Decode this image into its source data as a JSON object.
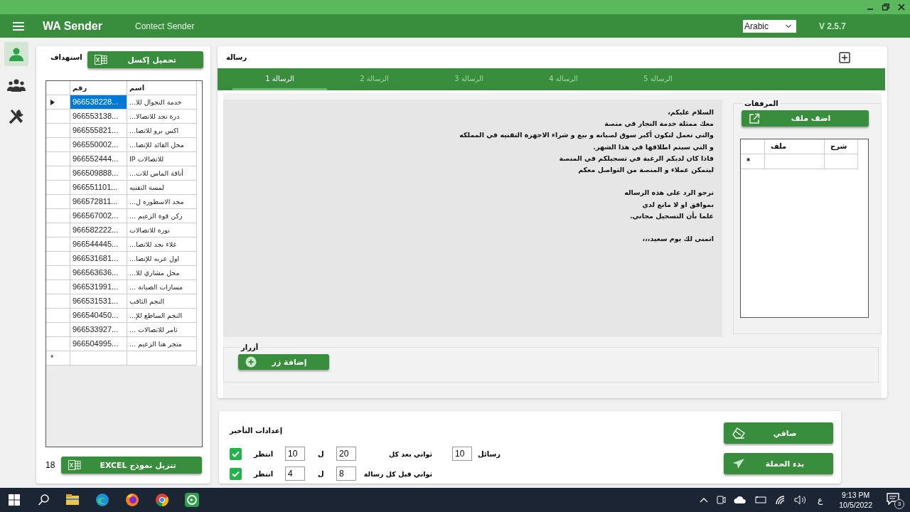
{
  "header": {
    "title": "WA Sender",
    "subtitle": "Contect Sender",
    "language": "Arabic",
    "version": "V 2.5.7"
  },
  "sidebar": {
    "items": [
      {
        "kind": "person",
        "selected": true
      },
      {
        "kind": "group",
        "selected": false
      },
      {
        "kind": "tools",
        "selected": false
      }
    ]
  },
  "targets": {
    "title": "استهداف",
    "load_button": "تحميل إكسل",
    "columns": [
      "اسم",
      "رقم"
    ],
    "rows": [
      {
        "number": "966538228...",
        "name": "خدمة التجوال للا...",
        "selected": true
      },
      {
        "number": "966553138...",
        "name": "درة نجد للاتصالا...",
        "selected": false
      },
      {
        "number": "966555821...",
        "name": "اكس برو للاتصا...",
        "selected": false
      },
      {
        "number": "966550002...",
        "name": "محل القائد للإتصا...",
        "selected": false
      },
      {
        "number": "966552444...",
        "name": "للاتصالات IP",
        "selected": false
      },
      {
        "number": "966509888...",
        "name": "أناقة الماس للات...",
        "selected": false
      },
      {
        "number": "966551101...",
        "name": "لمسة التقنيه",
        "selected": false
      },
      {
        "number": "966572811...",
        "name": "مجد الاسطوره ل...",
        "selected": false
      },
      {
        "number": "966567002...",
        "name": "ركن قوة الزعيم ...",
        "selected": false
      },
      {
        "number": "966582222...",
        "name": "نوره للاتصالات",
        "selected": false
      },
      {
        "number": "966544445...",
        "name": "غلاء نجد للاتصا...",
        "selected": false
      },
      {
        "number": "966531681...",
        "name": "اول عربه للإتصا...",
        "selected": false
      },
      {
        "number": "966563636...",
        "name": "محل مشاري للا...",
        "selected": false
      },
      {
        "number": "966531991...",
        "name": "مسارات الصيانة ...",
        "selected": false
      },
      {
        "number": "966531531...",
        "name": "النجم الثاقب",
        "selected": false
      },
      {
        "number": "966540450...",
        "name": "النجم الساطع للإ...",
        "selected": false
      },
      {
        "number": "966533927...",
        "name": "ثامر للاتصالات ...",
        "selected": false
      },
      {
        "number": "966504995...",
        "name": "متجر هنا الزعيم ...",
        "selected": false
      }
    ],
    "new_row_marker": "*",
    "count": "18",
    "template_button": "EXCEL تنزيل نموذج"
  },
  "message": {
    "title": "رسالة",
    "tabs": [
      {
        "label": "الرسالة 5",
        "selected": false
      },
      {
        "label": "الرسالة 4",
        "selected": false
      },
      {
        "label": "الرسالة 3",
        "selected": false
      },
      {
        "label": "الرسالة 2",
        "selected": false
      },
      {
        "label": "الرسالة 1",
        "selected": true
      }
    ],
    "body": "السلام عليكم،\nمعك ممثلة خدمة التجار في منصة\nوالتي تعمل لتكون أكبر سوق لصيانه و بيع و شراء الاجهزة التقنيه في المملكه\nو التي سيتم اطلاقها في هذا الشهر.\nفاذا كان لديكم الرغبة في تسجيلكم في المنصة\nليتمكن عملاء و المنصة من التواصل معكم\n\nنرجو الرد على هذه الرساله\nبموافق او لا مانع لدي\nعلما بأن التسجيل مجاني.\n\nاتمنى لك يوم سعيد،،،",
    "attachments": {
      "title": "المرفقات",
      "add_button": "اضف ملف",
      "columns": [
        "شرح",
        "ملف"
      ],
      "new_row_marker": "*"
    },
    "buttons_group": {
      "title": "أزرار",
      "add_button": "إضافة زر"
    }
  },
  "delay": {
    "title": "إعدادات التأخير",
    "rows": [
      {
        "checked": true,
        "wait_label": "انتظر",
        "min": "10",
        "to_label": "ل",
        "max": "20",
        "unit_label": "ثواني بعد كل",
        "count": "10",
        "count_label": "رسائل"
      },
      {
        "checked": true,
        "wait_label": "انتظر",
        "min": "4",
        "to_label": "ل",
        "max": "8",
        "unit_label": "ثواني قبل كل رسالة"
      }
    ],
    "clear_button": "صافي",
    "start_button": "بدء الحملة"
  },
  "taskbar": {
    "apps": [
      {
        "kind": "explorer"
      },
      {
        "kind": "edge"
      },
      {
        "kind": "firefox"
      },
      {
        "kind": "chrome"
      },
      {
        "kind": "wa"
      }
    ],
    "input_language": "ع",
    "time": "9:13 PM",
    "date": "10/5/2022",
    "notifications": "3"
  }
}
